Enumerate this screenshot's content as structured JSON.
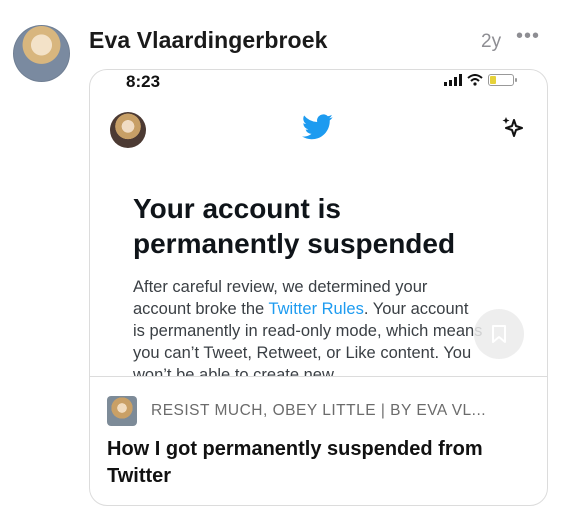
{
  "post": {
    "author": "Eva Vlaardingerbroek",
    "age": "2y",
    "more": "•••"
  },
  "screenshot": {
    "time": "8:23",
    "headline": "Your account is permanently suspended",
    "body_before_link": "After careful review, we determined your account broke the ",
    "link": "Twitter Rules",
    "body_after_link": ". Your account is permanently in read-only mode, which means you can’t Tweet, Retweet, or Like content. You won’t be able to create new"
  },
  "article": {
    "publication": "RESIST MUCH, OBEY LITTLE | BY EVA VL...",
    "title": "How I got permanently suspended from Twitter"
  },
  "colors": {
    "twitter_blue": "#1d9bf0",
    "muted": "#8e8e93"
  },
  "icons": [
    "more-icon",
    "twitter-bird-icon",
    "sparkle-icon",
    "bookmark-icon"
  ]
}
